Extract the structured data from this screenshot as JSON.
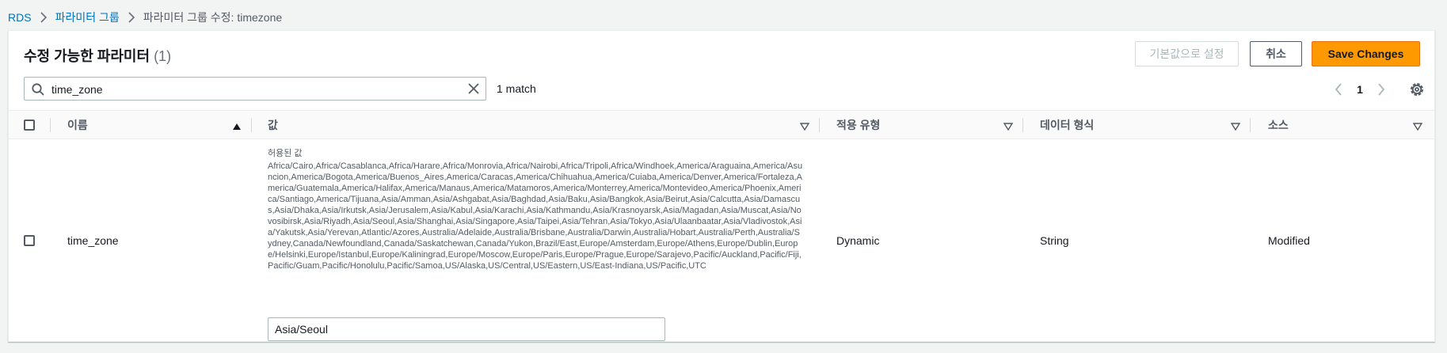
{
  "breadcrumb": {
    "items": [
      "RDS",
      "파라미터 그룹"
    ],
    "current": "파라미터 그룹 수정: timezone"
  },
  "header": {
    "title": "수정 가능한 파라미터",
    "count": "(1)"
  },
  "buttons": {
    "reset_default": "기본값으로 설정",
    "cancel": "취소",
    "save": "Save Changes"
  },
  "search": {
    "value": "time_zone",
    "match_text": "1 match"
  },
  "pagination": {
    "current_page": "1"
  },
  "table": {
    "columns": [
      "이름",
      "값",
      "적용 유형",
      "데이터 형식",
      "소스"
    ],
    "rows": [
      {
        "name": "time_zone",
        "allowed_label": "허용된 값",
        "allowed_values": "Africa/Cairo,Africa/Casablanca,Africa/Harare,Africa/Monrovia,Africa/Nairobi,Africa/Tripoli,Africa/Windhoek,America/Araguaina,America/Asuncion,America/Bogota,America/Buenos_Aires,America/Caracas,America/Chihuahua,America/Cuiaba,America/Denver,America/Fortaleza,America/Guatemala,America/Halifax,America/Manaus,America/Matamoros,America/Monterrey,America/Montevideo,America/Phoenix,America/Santiago,America/Tijuana,Asia/Amman,Asia/Ashgabat,Asia/Baghdad,Asia/Baku,Asia/Bangkok,Asia/Beirut,Asia/Calcutta,Asia/Damascus,Asia/Dhaka,Asia/Irkutsk,Asia/Jerusalem,Asia/Kabul,Asia/Karachi,Asia/Kathmandu,Asia/Krasnoyarsk,Asia/Magadan,Asia/Muscat,Asia/Novosibirsk,Asia/Riyadh,Asia/Seoul,Asia/Shanghai,Asia/Singapore,Asia/Taipei,Asia/Tehran,Asia/Tokyo,Asia/Ulaanbaatar,Asia/Vladivostok,Asia/Yakutsk,Asia/Yerevan,Atlantic/Azores,Australia/Adelaide,Australia/Brisbane,Australia/Darwin,Australia/Hobart,Australia/Perth,Australia/Sydney,Canada/Newfoundland,Canada/Saskatchewan,Canada/Yukon,Brazil/East,Europe/Amsterdam,Europe/Athens,Europe/Dublin,Europe/Helsinki,Europe/Istanbul,Europe/Kaliningrad,Europe/Moscow,Europe/Paris,Europe/Prague,Europe/Sarajevo,Pacific/Auckland,Pacific/Fiji,Pacific/Guam,Pacific/Honolulu,Pacific/Samoa,US/Alaska,US/Central,US/Eastern,US/East-Indiana,US/Pacific,UTC",
        "value": "Asia/Seoul",
        "apply_type": "Dynamic",
        "data_type": "String",
        "source": "Modified"
      }
    ]
  },
  "colors": {
    "link": "#0073bb",
    "primary_button": "#ff9900",
    "background": "#f2f3f3"
  }
}
